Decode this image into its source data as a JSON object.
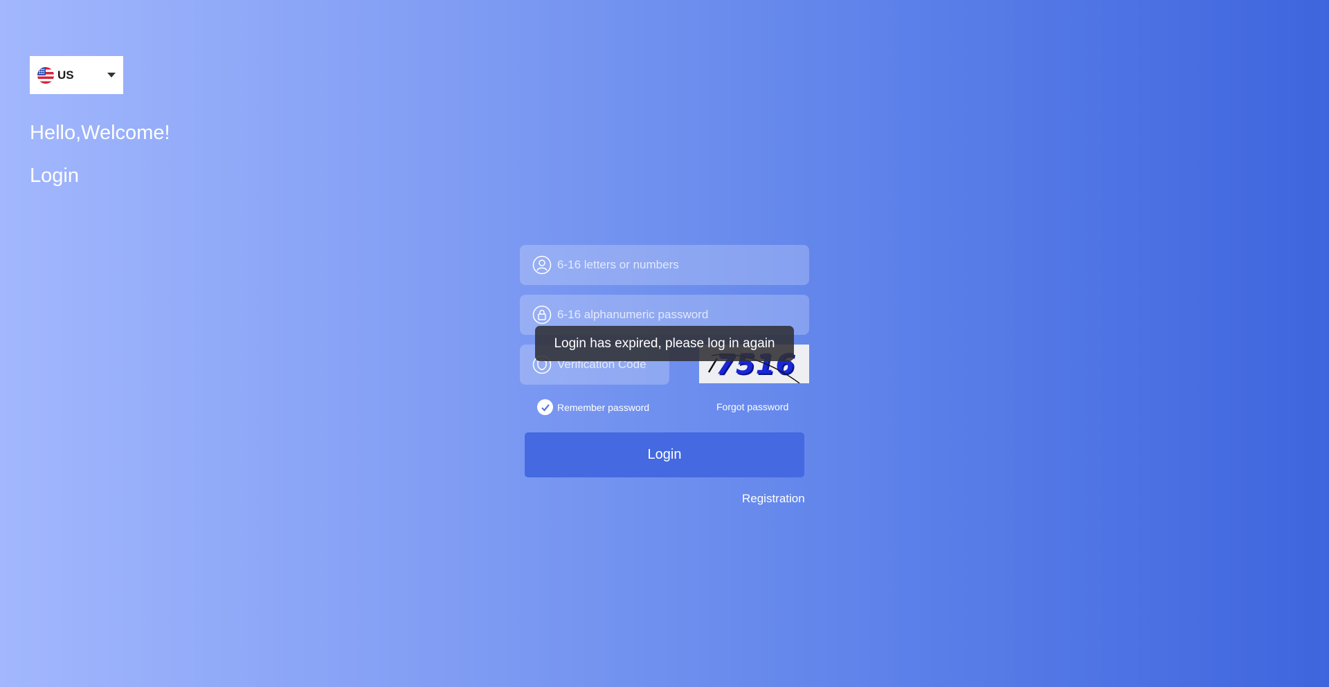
{
  "language": {
    "code": "US",
    "flag": "us-flag-icon"
  },
  "heading": {
    "welcome": "Hello,Welcome!",
    "title": "Login"
  },
  "form": {
    "username_placeholder": "6-16 letters or numbers",
    "password_placeholder": "6-16 alphanumeric password",
    "code_placeholder": "Verification Code",
    "captcha_text": "7516",
    "remember_label": "Remember password",
    "remember_checked": true,
    "forgot_label": "Forgot password",
    "login_label": "Login",
    "register_label": "Registration"
  },
  "toast": {
    "message": "Login has expired, please log in again"
  },
  "colors": {
    "background_start": "#a2b7fd",
    "background_end": "#3f65de",
    "button": "#4469e0",
    "toast": "#303034"
  }
}
